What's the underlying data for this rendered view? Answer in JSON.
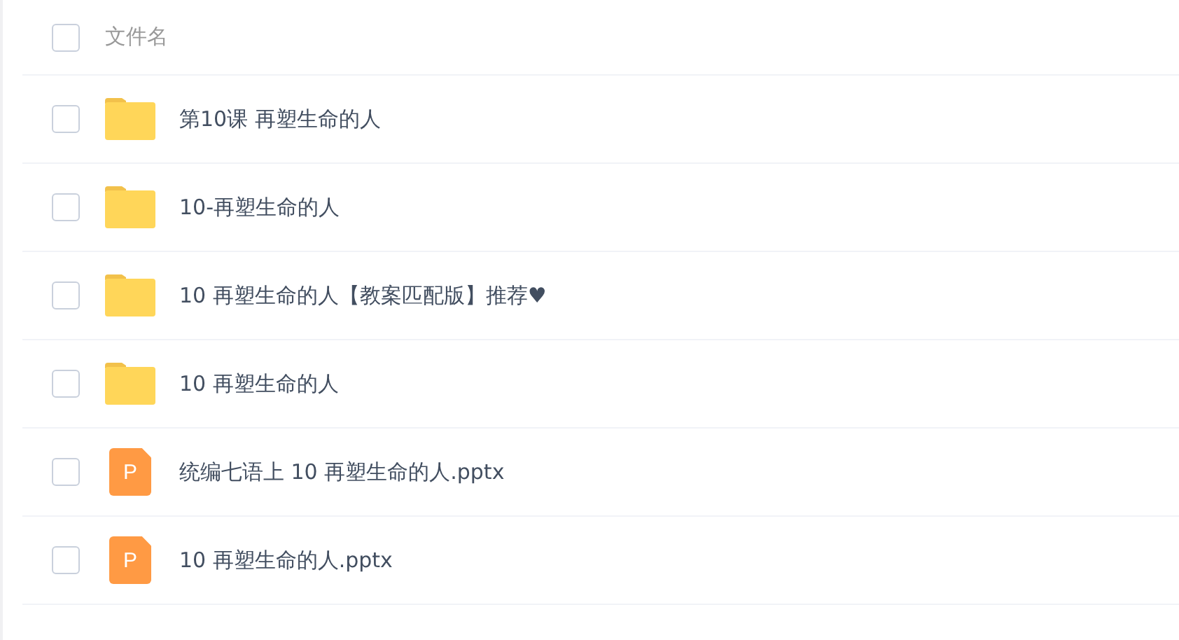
{
  "header": {
    "checked": false,
    "label": "文件名"
  },
  "files": [
    {
      "kind": "folder",
      "name": "第10课 再塑生命的人",
      "checked": false
    },
    {
      "kind": "folder",
      "name": "10-再塑生命的人",
      "checked": false
    },
    {
      "kind": "folder",
      "name": "10 再塑生命的人【教案匹配版】推荐♥",
      "checked": false
    },
    {
      "kind": "folder",
      "name": "10 再塑生命的人",
      "checked": false
    },
    {
      "kind": "pptx",
      "name": "统编七语上 10 再塑生命的人.pptx",
      "checked": false,
      "icon_letter": "P"
    },
    {
      "kind": "pptx",
      "name": "10 再塑生命的人.pptx",
      "checked": false,
      "icon_letter": "P"
    }
  ]
}
